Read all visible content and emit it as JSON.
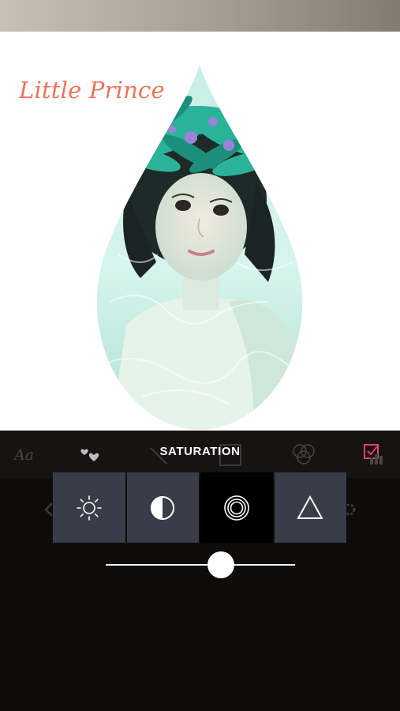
{
  "photo": {
    "caption": "Little Prince"
  },
  "toolbar": {
    "active_label": "SATURATION",
    "tools": [
      {
        "icon": "text-format-icon"
      },
      {
        "icon": "hearts-sticker-icon"
      },
      {
        "icon": "adjust-icon"
      },
      {
        "icon": "blend-circles-icon"
      },
      {
        "icon": "checkbox-grid-icon"
      }
    ]
  },
  "adjustments": [
    {
      "name": "brightness",
      "icon": "sun-icon",
      "active": false
    },
    {
      "name": "contrast",
      "icon": "half-circle-icon",
      "active": false
    },
    {
      "name": "saturation",
      "icon": "concentric-circles-icon",
      "active": true
    },
    {
      "name": "sharpen",
      "icon": "triangle-icon",
      "active": false
    }
  ],
  "slider": {
    "value": 0.61
  },
  "colors": {
    "caption": "#f0735a",
    "panel_bg": "#0e0c0b",
    "button_bg": "#383d48",
    "button_active_bg": "#000000"
  }
}
